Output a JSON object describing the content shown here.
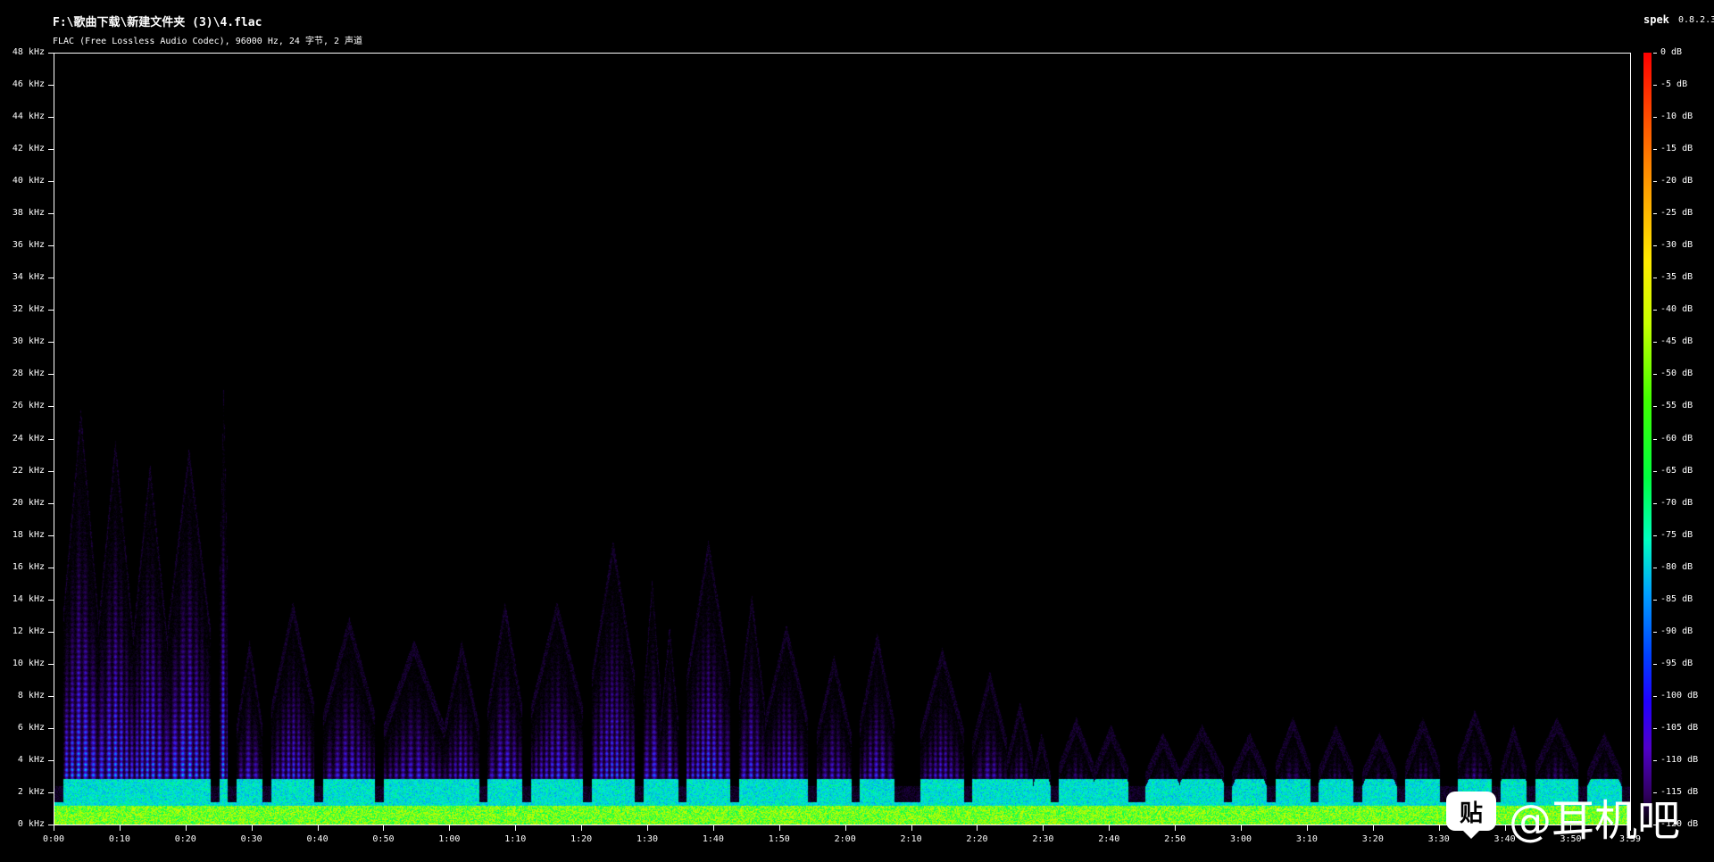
{
  "window": {
    "file_path": "F:\\歌曲下载\\新建文件夹 (3)\\4.flac",
    "file_info": "FLAC (Free Lossless Audio Codec), 96000 Hz, 24 字节, 2 声道",
    "app_name": "spek",
    "app_version": "0.8.2.3"
  },
  "frequency_axis": {
    "labels": [
      "48 kHz",
      "46 kHz",
      "44 kHz",
      "42 kHz",
      "40 kHz",
      "38 kHz",
      "36 kHz",
      "34 kHz",
      "32 kHz",
      "30 kHz",
      "28 kHz",
      "26 kHz",
      "24 kHz",
      "22 kHz",
      "20 kHz",
      "18 kHz",
      "16 kHz",
      "14 kHz",
      "12 kHz",
      "10 kHz",
      "8 kHz",
      "6 kHz",
      "4 kHz",
      "2 kHz",
      "0 kHz"
    ],
    "max_khz": 48
  },
  "time_axis": {
    "labels": [
      "0:00",
      "0:10",
      "0:20",
      "0:30",
      "0:40",
      "0:50",
      "1:00",
      "1:10",
      "1:20",
      "1:30",
      "1:40",
      "1:50",
      "2:00",
      "2:10",
      "2:20",
      "2:30",
      "2:40",
      "2:50",
      "3:00",
      "3:10",
      "3:20",
      "3:30",
      "3:40",
      "3:50",
      "3:59"
    ],
    "duration_seconds": 239
  },
  "db_scale": {
    "labels": [
      "0 dB",
      "-5 dB",
      "-10 dB",
      "-15 dB",
      "-20 dB",
      "-25 dB",
      "-30 dB",
      "-35 dB",
      "-40 dB",
      "-45 dB",
      "-50 dB",
      "-55 dB",
      "-60 dB",
      "-65 dB",
      "-70 dB",
      "-75 dB",
      "-80 dB",
      "-85 dB",
      "-90 dB",
      "-95 dB",
      "-100 dB",
      "-105 dB",
      "-110 dB",
      "-115 dB",
      "-120 dB"
    ],
    "min_db": -120,
    "max_db": 0
  },
  "watermark": {
    "text": "@耳机吧",
    "icon": "tieba-icon"
  },
  "colors": {
    "background": "#000000",
    "axis": "#ffffff"
  }
}
